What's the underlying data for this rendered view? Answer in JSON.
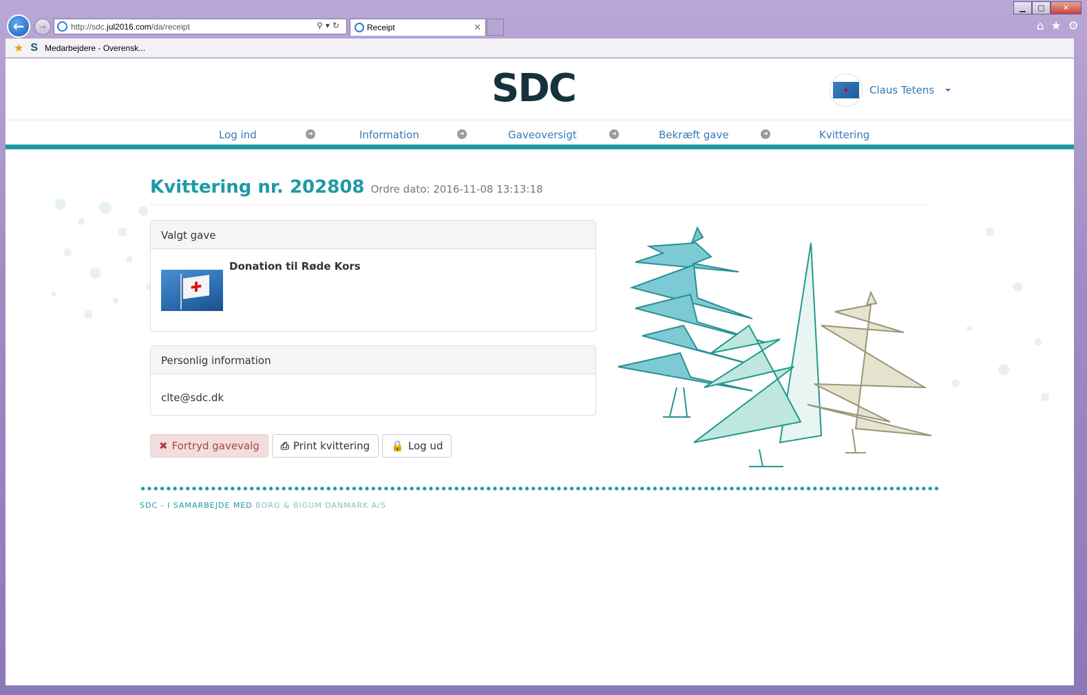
{
  "browser": {
    "address_prefix": "http://sdc.",
    "address_domain": "jul2016.com",
    "address_path": "/da/receipt",
    "tab_title": "Receipt",
    "favorite_label": "Medarbejdere - Overensk...",
    "min_label": "▁",
    "max_label": "▢",
    "close_label": "✕"
  },
  "header": {
    "logo_left": "SD",
    "logo_right": "C",
    "user_name": "Claus Tetens"
  },
  "steps": [
    {
      "label": "Log ind"
    },
    {
      "label": "Information"
    },
    {
      "label": "Gaveoversigt"
    },
    {
      "label": "Bekræft gave"
    },
    {
      "label": "Kvittering"
    }
  ],
  "receipt": {
    "title": "Kvittering nr. 202808",
    "order_date": "Ordre dato: 2016-11-08 13:13:18"
  },
  "gift_panel": {
    "heading": "Valgt gave",
    "gift_name": "Donation til Røde Kors"
  },
  "info_panel": {
    "heading": "Personlig information",
    "email": "clte@sdc.dk"
  },
  "actions": {
    "undo_label": "Fortryd gavevalg",
    "print_label": "Print kvittering",
    "logout_label": "Log ud"
  },
  "footer": {
    "primary": "SDC - I SAMARBEJDE MED",
    "secondary": "BORG & BIGUM DANMARK A/S"
  },
  "colors": {
    "accent": "#1d9aa5",
    "link": "#337ab7",
    "danger_bg": "#f2dede",
    "danger_text": "#a94442"
  }
}
